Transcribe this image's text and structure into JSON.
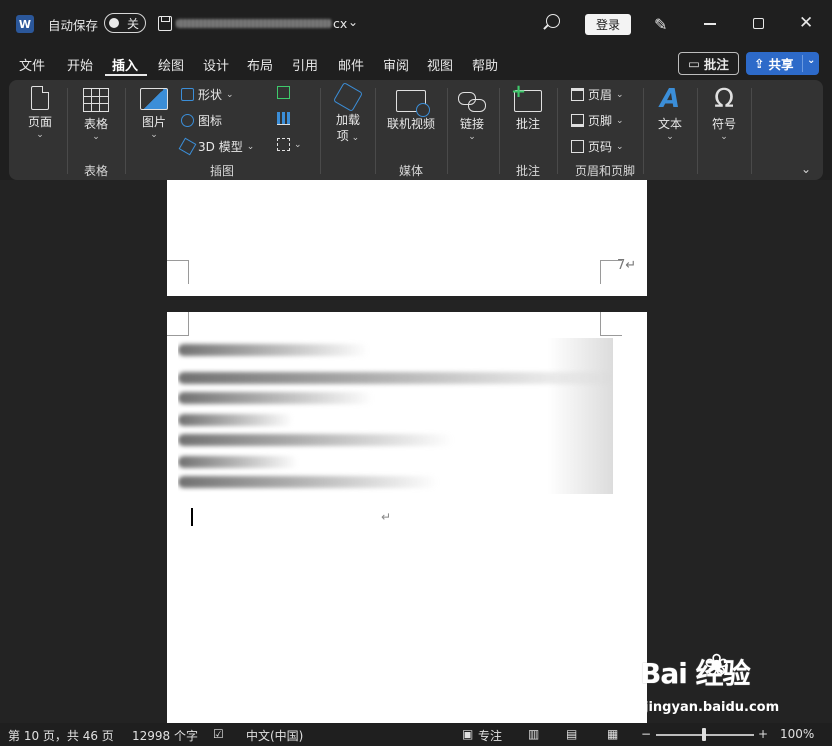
{
  "titlebar": {
    "app_logo_letter": "W",
    "autosave_label": "自动保存",
    "autosave_state": "关",
    "filename_suffix": "cx",
    "login_label": "登录"
  },
  "tabs": [
    {
      "label": "文件"
    },
    {
      "label": "开始"
    },
    {
      "label": "插入"
    },
    {
      "label": "绘图"
    },
    {
      "label": "设计"
    },
    {
      "label": "布局"
    },
    {
      "label": "引用"
    },
    {
      "label": "邮件"
    },
    {
      "label": "审阅"
    },
    {
      "label": "视图"
    },
    {
      "label": "帮助"
    }
  ],
  "active_tab": "插入",
  "header_buttons": {
    "comments_label": "批注",
    "share_label": "共享"
  },
  "ribbon": {
    "pages": "页面",
    "table": "表格",
    "table_group": "表格",
    "pictures": "图片",
    "shapes": "形状",
    "icons": "图标",
    "model_3d": "3D 模型",
    "illustrations_group": "插图",
    "addins_line1": "加载",
    "addins_line2": "项",
    "online_video": "联机视频",
    "media_group": "媒体",
    "link": "链接",
    "comment": "批注",
    "comments_group": "批注",
    "header": "页眉",
    "footer": "页脚",
    "page_number": "页码",
    "header_footer_group": "页眉和页脚",
    "text": "文本",
    "symbols": "符号"
  },
  "document": {
    "page_number_shown": "7",
    "paragraph_mark": "↵"
  },
  "statusbar": {
    "page_info": "第 10 页，共 46 页",
    "word_count": "12998 个字",
    "language": "中文(中国)",
    "focus": "专注",
    "zoom": "100%"
  },
  "watermark": {
    "brand": "Bai  经验",
    "sub": "jingyan.baidu.com"
  },
  "colors": {
    "accent_blue": "#2d6ac9",
    "icon_blue": "#3b8ed8",
    "ribbon_bg": "#333333",
    "window_bg": "#1f1f1f"
  }
}
